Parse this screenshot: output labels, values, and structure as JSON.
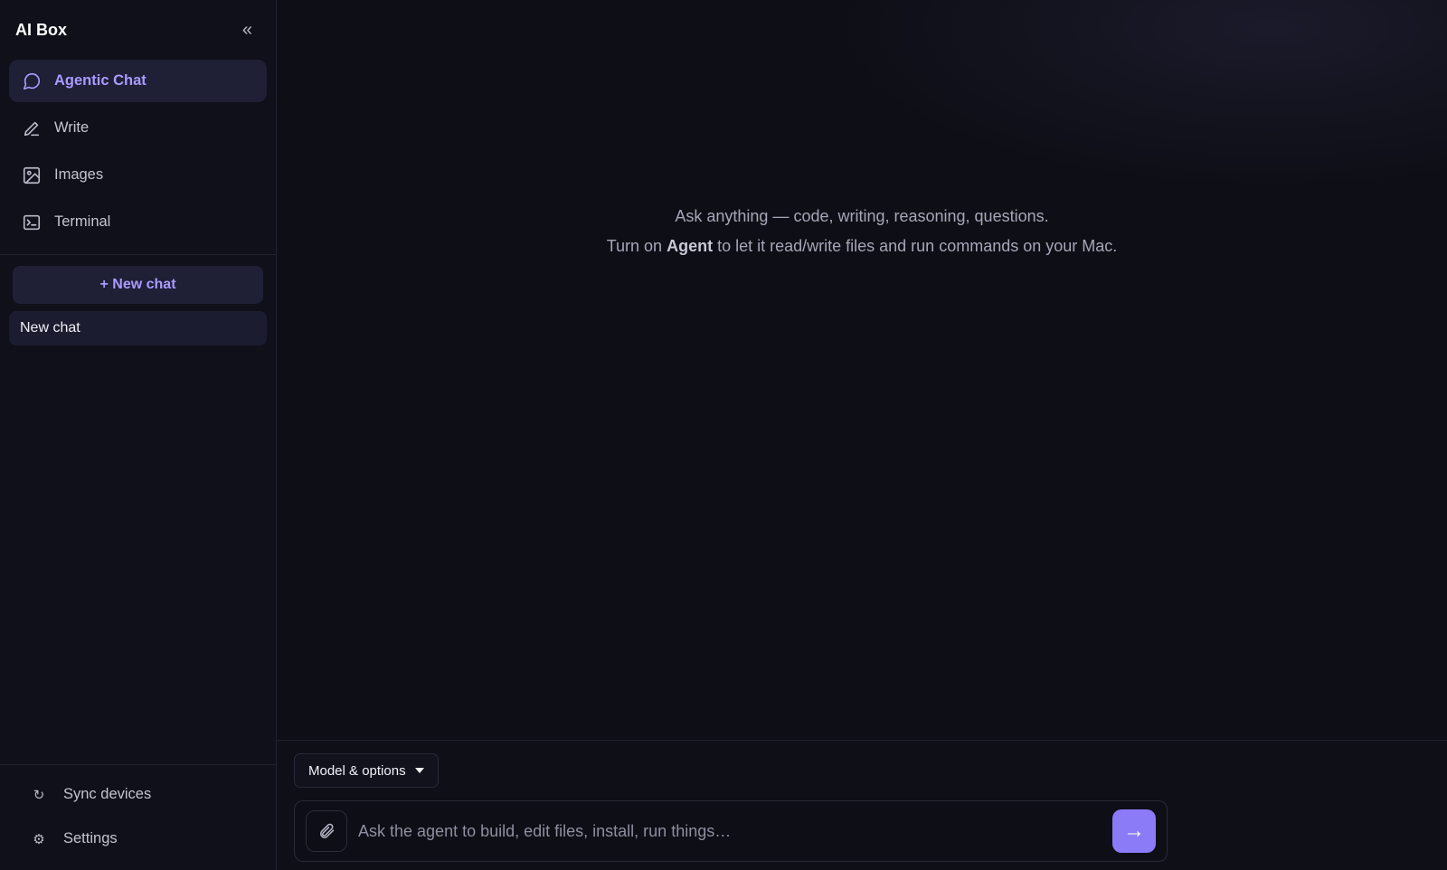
{
  "sidebar": {
    "title": "AI Box",
    "collapse_glyph": "«",
    "nav": [
      {
        "label": "Agentic Chat",
        "icon": "chat-bubble-icon",
        "active": true
      },
      {
        "label": "Write",
        "icon": "pencil-icon",
        "active": false
      },
      {
        "label": "Images",
        "icon": "image-icon",
        "active": false
      },
      {
        "label": "Terminal",
        "icon": "terminal-icon",
        "active": false
      }
    ],
    "new_chat_label": "+ New chat",
    "chats": [
      {
        "label": "New chat"
      }
    ],
    "bottom": [
      {
        "label": "Sync devices",
        "glyph": "↻",
        "icon": "sync-icon"
      },
      {
        "label": "Settings",
        "glyph": "⚙",
        "icon": "gear-icon"
      }
    ]
  },
  "main": {
    "hint_line1": "Ask anything — code, writing, reasoning, questions.",
    "hint_line2_pre": "Turn on ",
    "hint_line2_bold": "Agent",
    "hint_line2_post": " to let it read/write files and run commands on your Mac."
  },
  "composer": {
    "model_label": "Model & options",
    "placeholder": "Ask the agent to build, edit files, install, run things…",
    "send_glyph": "→"
  },
  "colors": {
    "accent": "#8b7bf7",
    "accent_text": "#a89bff",
    "background": "#0e0e16",
    "sidebar_bg": "#10101a"
  }
}
